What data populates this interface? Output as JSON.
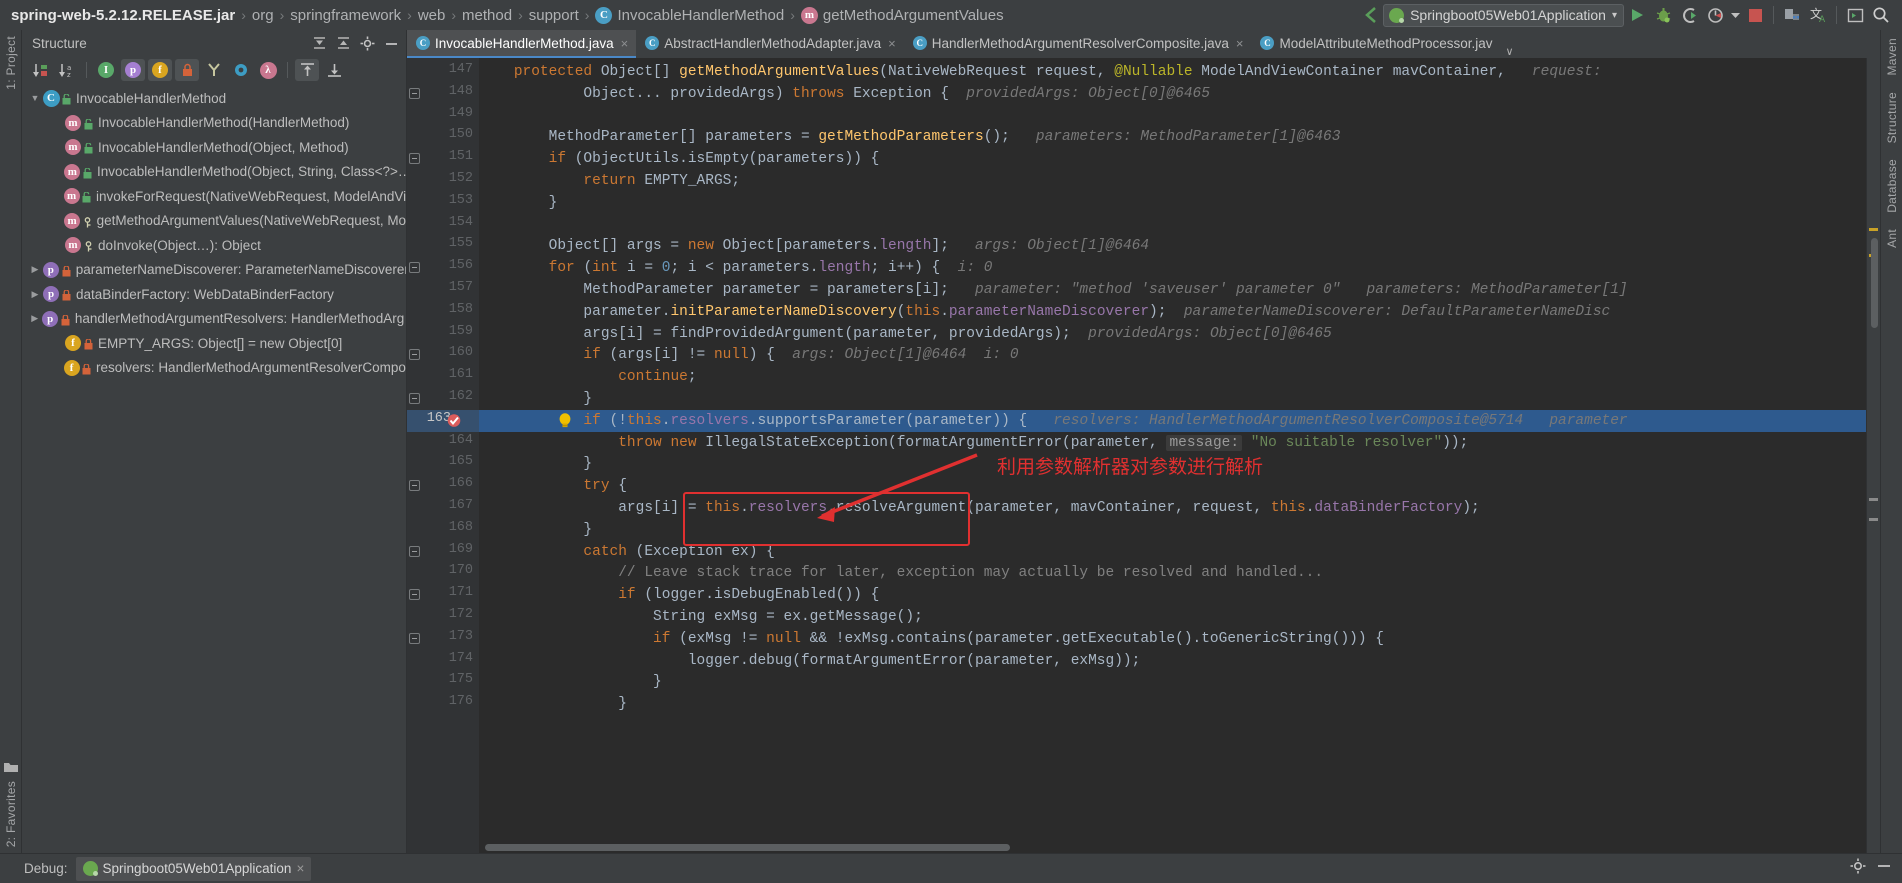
{
  "navbar": {
    "breadcrumbs": [
      {
        "label": "spring-web-5.2.12.RELEASE.jar",
        "icon": ""
      },
      {
        "label": "org",
        "icon": ""
      },
      {
        "label": "springframework",
        "icon": ""
      },
      {
        "label": "web",
        "icon": ""
      },
      {
        "label": "method",
        "icon": ""
      },
      {
        "label": "support",
        "icon": ""
      },
      {
        "label": "InvocableHandlerMethod",
        "icon": "class-icon"
      },
      {
        "label": "getMethodArgumentValues",
        "icon": "method-icon"
      }
    ],
    "separator": "›",
    "run_configuration": "Springboot05Web01Application",
    "dropdown_caret": "▾",
    "toolbar_icons": [
      "run-icon",
      "debug-icon",
      "run-with-coverage-icon",
      "profiler-icon",
      "profiler-dropdown-icon",
      "stop-icon",
      "build-icon",
      "translate-icon",
      "terminal-icon",
      "search-everywhere-icon"
    ]
  },
  "left_strip": {
    "top_label": "1: Project",
    "bottom_label": "2: Favorites"
  },
  "right_strip": {
    "labels": [
      "Maven",
      "Structure",
      "Database",
      "Ant"
    ]
  },
  "structure": {
    "title": "Structure",
    "header_icons": [
      "expand-all-icon",
      "collapse-all-icon",
      "settings-icon",
      "hide-icon"
    ],
    "toolbar_icons": [
      "sort-by-visibility-icon",
      "sort-alphabetically-icon",
      "show-inherited-icon",
      "show-properties-icon",
      "show-fields-icon",
      "show-non-public-icon",
      "show-anonymous-icon",
      "show-interfaces-icon",
      "show-lambdas-icon",
      "autoscroll-to-source-icon",
      "autoscroll-from-source-icon"
    ],
    "tree": [
      {
        "label": "InvocableHandlerMethod",
        "icon": "class-icon",
        "indent": 0,
        "arrow": "▼",
        "vis": "public"
      },
      {
        "label": "InvocableHandlerMethod(HandlerMethod)",
        "icon": "method-icon",
        "indent": 1,
        "arrow": "",
        "vis": "public"
      },
      {
        "label": "InvocableHandlerMethod(Object, Method)",
        "icon": "method-icon",
        "indent": 1,
        "arrow": "",
        "vis": "public"
      },
      {
        "label": "InvocableHandlerMethod(Object, String, Class<?>…)",
        "icon": "method-icon",
        "indent": 1,
        "arrow": "",
        "vis": "public"
      },
      {
        "label": "invokeForRequest(NativeWebRequest, ModelAndVie…",
        "icon": "method-icon",
        "indent": 1,
        "arrow": "",
        "vis": "public"
      },
      {
        "label": "getMethodArgumentValues(NativeWebRequest, Mo…",
        "icon": "method-icon",
        "indent": 1,
        "arrow": "",
        "vis": "protected"
      },
      {
        "label": "doInvoke(Object…): Object",
        "icon": "method-icon",
        "indent": 1,
        "arrow": "",
        "vis": "protected"
      },
      {
        "label": "parameterNameDiscoverer: ParameterNameDiscoverer",
        "icon": "property-icon",
        "indent": 0,
        "arrow": "▶",
        "vis": "private"
      },
      {
        "label": "dataBinderFactory: WebDataBinderFactory",
        "icon": "property-icon",
        "indent": 0,
        "arrow": "▶",
        "vis": "private"
      },
      {
        "label": "handlerMethodArgumentResolvers: HandlerMethodArg…",
        "icon": "property-icon",
        "indent": 0,
        "arrow": "▶",
        "vis": "private"
      },
      {
        "label": "EMPTY_ARGS: Object[] = new Object[0]",
        "icon": "field-icon",
        "indent": 1,
        "arrow": "",
        "vis": "private"
      },
      {
        "label": "resolvers: HandlerMethodArgumentResolverCompos…",
        "icon": "field-icon",
        "indent": 1,
        "arrow": "",
        "vis": "private"
      }
    ]
  },
  "tabs": [
    {
      "label": "InvocableHandlerMethod.java",
      "active": true,
      "closable": true
    },
    {
      "label": "AbstractHandlerMethodAdapter.java",
      "active": false,
      "closable": true
    },
    {
      "label": "HandlerMethodArgumentResolverComposite.java",
      "active": false,
      "closable": true
    },
    {
      "label": "ModelAttributeMethodProcessor.jav",
      "active": false,
      "closable": false
    }
  ],
  "editor": {
    "first_line": 147,
    "highlight_line": 163,
    "breakpoint_line": 163,
    "lines": [
      {
        "n": 147,
        "fold": false,
        "segments": [
          {
            "t": "    ",
            "c": "plain"
          },
          {
            "t": "protected ",
            "c": "kw"
          },
          {
            "t": "Object[] ",
            "c": "plain"
          },
          {
            "t": "getMethodArgumentValues",
            "c": "fn"
          },
          {
            "t": "(NativeWebRequest request, ",
            "c": "plain"
          },
          {
            "t": "@Nullable ",
            "c": "ann"
          },
          {
            "t": "ModelAndViewContainer mavContainer,",
            "c": "plain"
          },
          {
            "t": "   request:",
            "c": "hint"
          }
        ]
      },
      {
        "n": 148,
        "fold": true,
        "segments": [
          {
            "t": "            Object... providedArgs) ",
            "c": "plain"
          },
          {
            "t": "throws ",
            "c": "kw"
          },
          {
            "t": "Exception {",
            "c": "plain"
          },
          {
            "t": "  providedArgs: Object[0]@6465",
            "c": "hint"
          }
        ]
      },
      {
        "n": 149,
        "fold": false,
        "segments": []
      },
      {
        "n": 150,
        "fold": false,
        "segments": [
          {
            "t": "        MethodParameter[] parameters = ",
            "c": "plain"
          },
          {
            "t": "getMethodParameters",
            "c": "fn"
          },
          {
            "t": "();",
            "c": "plain"
          },
          {
            "t": "   parameters: MethodParameter[1]@6463",
            "c": "hint"
          }
        ]
      },
      {
        "n": 151,
        "fold": true,
        "segments": [
          {
            "t": "        ",
            "c": "plain"
          },
          {
            "t": "if ",
            "c": "kw"
          },
          {
            "t": "(ObjectUtils.",
            "c": "plain"
          },
          {
            "t": "isEmpty",
            "c": "stat"
          },
          {
            "t": "(parameters)) {",
            "c": "plain"
          }
        ]
      },
      {
        "n": 152,
        "fold": false,
        "segments": [
          {
            "t": "            ",
            "c": "plain"
          },
          {
            "t": "return ",
            "c": "kw"
          },
          {
            "t": "EMPTY_ARGS",
            "c": "stat"
          },
          {
            "t": ";",
            "c": "plain"
          }
        ]
      },
      {
        "n": 153,
        "fold": false,
        "segments": [
          {
            "t": "        }",
            "c": "plain"
          }
        ]
      },
      {
        "n": 154,
        "fold": false,
        "segments": []
      },
      {
        "n": 155,
        "fold": false,
        "segments": [
          {
            "t": "        Object[] args = ",
            "c": "plain"
          },
          {
            "t": "new ",
            "c": "kw"
          },
          {
            "t": "Object[parameters.",
            "c": "plain"
          },
          {
            "t": "length",
            "c": "fld"
          },
          {
            "t": "];",
            "c": "plain"
          },
          {
            "t": "   args: Object[1]@6464",
            "c": "hint"
          }
        ]
      },
      {
        "n": 156,
        "fold": true,
        "segments": [
          {
            "t": "        ",
            "c": "plain"
          },
          {
            "t": "for ",
            "c": "kw"
          },
          {
            "t": "(",
            "c": "plain"
          },
          {
            "t": "int ",
            "c": "kw"
          },
          {
            "t": "i = ",
            "c": "plain"
          },
          {
            "t": "0",
            "c": "num"
          },
          {
            "t": "; i < parameters.",
            "c": "plain"
          },
          {
            "t": "length",
            "c": "fld"
          },
          {
            "t": "; i++) {",
            "c": "plain"
          },
          {
            "t": "  i: 0",
            "c": "hint"
          }
        ]
      },
      {
        "n": 157,
        "fold": false,
        "segments": [
          {
            "t": "            MethodParameter parameter = parameters[i];",
            "c": "plain"
          },
          {
            "t": "   parameter: \"method 'saveuser' parameter 0\"   parameters: MethodParameter[1]",
            "c": "hint"
          }
        ]
      },
      {
        "n": 158,
        "fold": false,
        "segments": [
          {
            "t": "            parameter.",
            "c": "plain"
          },
          {
            "t": "initParameterNameDiscovery",
            "c": "fn"
          },
          {
            "t": "(",
            "c": "plain"
          },
          {
            "t": "this",
            "c": "kw"
          },
          {
            "t": ".",
            "c": "plain"
          },
          {
            "t": "parameterNameDiscoverer",
            "c": "fld"
          },
          {
            "t": ");",
            "c": "plain"
          },
          {
            "t": "  parameterNameDiscoverer: DefaultParameterNameDisc",
            "c": "hint"
          }
        ]
      },
      {
        "n": 159,
        "fold": false,
        "segments": [
          {
            "t": "            args[i] = ",
            "c": "plain"
          },
          {
            "t": "findProvidedArgument",
            "c": "stat"
          },
          {
            "t": "(parameter, providedArgs);",
            "c": "plain"
          },
          {
            "t": "  providedArgs: Object[0]@6465",
            "c": "hint"
          }
        ]
      },
      {
        "n": 160,
        "fold": true,
        "segments": [
          {
            "t": "            ",
            "c": "plain"
          },
          {
            "t": "if ",
            "c": "kw"
          },
          {
            "t": "(args[i] != ",
            "c": "plain"
          },
          {
            "t": "null",
            "c": "kw"
          },
          {
            "t": ") {",
            "c": "plain"
          },
          {
            "t": "  args: Object[1]@6464  i: 0",
            "c": "hint"
          }
        ]
      },
      {
        "n": 161,
        "fold": false,
        "segments": [
          {
            "t": "                ",
            "c": "plain"
          },
          {
            "t": "continue",
            "c": "kw"
          },
          {
            "t": ";",
            "c": "plain"
          }
        ]
      },
      {
        "n": 162,
        "fold": true,
        "segments": [
          {
            "t": "            }",
            "c": "plain"
          }
        ]
      },
      {
        "n": 163,
        "fold": true,
        "segments": [
          {
            "t": "            ",
            "c": "plain"
          },
          {
            "t": "if ",
            "c": "kw"
          },
          {
            "t": "(!",
            "c": "plain"
          },
          {
            "t": "this",
            "c": "kw"
          },
          {
            "t": ".",
            "c": "plain"
          },
          {
            "t": "resolvers",
            "c": "fld"
          },
          {
            "t": ".supportsParameter(parameter)) {",
            "c": "plain"
          },
          {
            "t": "   resolvers: HandlerMethodArgumentResolverComposite@5714   parameter",
            "c": "hint"
          }
        ]
      },
      {
        "n": 164,
        "fold": false,
        "segments": [
          {
            "t": "                ",
            "c": "plain"
          },
          {
            "t": "throw new ",
            "c": "kw"
          },
          {
            "t": "IllegalStateException(",
            "c": "plain"
          },
          {
            "t": "formatArgumentError",
            "c": "stat"
          },
          {
            "t": "(parameter, ",
            "c": "plain"
          },
          {
            "t": "message:",
            "c": "hintbox"
          },
          {
            "t": " ",
            "c": "plain"
          },
          {
            "t": "\"No suitable resolver\"",
            "c": "st"
          },
          {
            "t": "));",
            "c": "plain"
          }
        ]
      },
      {
        "n": 165,
        "fold": false,
        "segments": [
          {
            "t": "            }",
            "c": "plain"
          }
        ]
      },
      {
        "n": 166,
        "fold": true,
        "segments": [
          {
            "t": "            ",
            "c": "plain"
          },
          {
            "t": "try ",
            "c": "kw"
          },
          {
            "t": "{",
            "c": "plain"
          }
        ]
      },
      {
        "n": 167,
        "fold": false,
        "segments": [
          {
            "t": "                args[i] = ",
            "c": "plain"
          },
          {
            "t": "this",
            "c": "kw"
          },
          {
            "t": ".",
            "c": "plain"
          },
          {
            "t": "resolvers",
            "c": "fld"
          },
          {
            "t": ".resolveArgument(parameter, mavContainer, request, ",
            "c": "plain"
          },
          {
            "t": "this",
            "c": "kw"
          },
          {
            "t": ".",
            "c": "plain"
          },
          {
            "t": "dataBinderFactory",
            "c": "fld"
          },
          {
            "t": ");",
            "c": "plain"
          }
        ]
      },
      {
        "n": 168,
        "fold": false,
        "segments": [
          {
            "t": "            }",
            "c": "plain"
          }
        ]
      },
      {
        "n": 169,
        "fold": true,
        "segments": [
          {
            "t": "            ",
            "c": "plain"
          },
          {
            "t": "catch ",
            "c": "kw"
          },
          {
            "t": "(Exception ex) {",
            "c": "plain"
          }
        ]
      },
      {
        "n": 170,
        "fold": false,
        "segments": [
          {
            "t": "                ",
            "c": "plain"
          },
          {
            "t": "// Leave stack trace for later, exception may actually be resolved and handled...",
            "c": "cm"
          }
        ]
      },
      {
        "n": 171,
        "fold": true,
        "segments": [
          {
            "t": "                ",
            "c": "plain"
          },
          {
            "t": "if ",
            "c": "kw"
          },
          {
            "t": "(logger.isDebugEnabled()) {",
            "c": "plain"
          }
        ]
      },
      {
        "n": 172,
        "fold": false,
        "segments": [
          {
            "t": "                    String exMsg = ex.getMessage();",
            "c": "plain"
          }
        ]
      },
      {
        "n": 173,
        "fold": true,
        "segments": [
          {
            "t": "                    ",
            "c": "plain"
          },
          {
            "t": "if ",
            "c": "kw"
          },
          {
            "t": "(exMsg != ",
            "c": "plain"
          },
          {
            "t": "null ",
            "c": "kw"
          },
          {
            "t": "&& !exMsg.contains(parameter.getExecutable().toGenericString())) {",
            "c": "plain"
          }
        ]
      },
      {
        "n": 174,
        "fold": false,
        "segments": [
          {
            "t": "                        logger.debug(",
            "c": "plain"
          },
          {
            "t": "formatArgumentError",
            "c": "stat"
          },
          {
            "t": "(parameter, exMsg));",
            "c": "plain"
          }
        ]
      },
      {
        "n": 175,
        "fold": false,
        "segments": [
          {
            "t": "                    }",
            "c": "plain"
          }
        ]
      },
      {
        "n": 176,
        "fold": false,
        "segments": [
          {
            "t": "                }",
            "c": "plain"
          }
        ]
      }
    ]
  },
  "annotation": {
    "text": "利用参数解析器对参数进行解析",
    "color": "#e03030",
    "box_target_line": 167,
    "arrow": "arrow-left-icon"
  },
  "bottom": {
    "debug_label": "Debug:",
    "session_tab": "Springboot05Web01Application",
    "close_glyph": "×",
    "right_icons": [
      "settings-icon",
      "hide-icon"
    ]
  }
}
